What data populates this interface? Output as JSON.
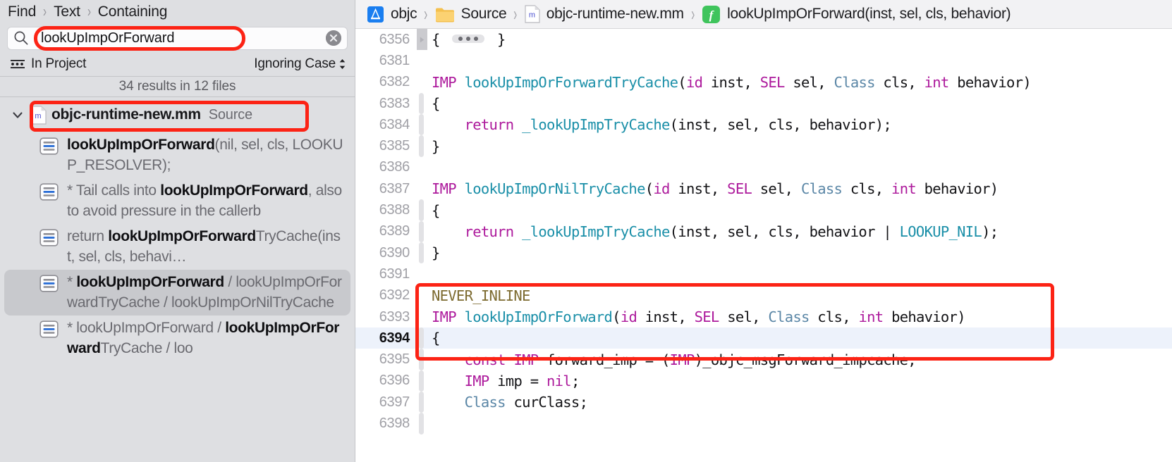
{
  "sidebar": {
    "find_scope": {
      "parts": [
        "Find",
        "Text",
        "Containing"
      ],
      "separator": "›"
    },
    "search": {
      "value": "lookUpImpOrForward",
      "placeholder": "Search",
      "magnifier_icon": "search-icon",
      "clear_icon": "clear-icon"
    },
    "filter": {
      "scope_icon": "in-project-icon",
      "scope_label": "In Project",
      "case_label": "Ignoring Case",
      "stepper_icon": "chevron-up-down-icon"
    },
    "results_count": "34 results in 12 files",
    "file_group": {
      "disclosure_icon": "chevron-down-icon",
      "file_icon": "objc-mm-file-icon",
      "name": "objc-runtime-new.mm",
      "kind": "Source",
      "expanded": true
    },
    "matches": [
      {
        "icon": "text-match-icon",
        "selected": false,
        "runs": [
          {
            "text": "lookUpImpOrForward",
            "bold": true
          },
          {
            "text": "(nil, sel, cls, LOOKUP_RESOLVER);",
            "bold": false
          }
        ]
      },
      {
        "icon": "text-match-icon",
        "selected": false,
        "runs": [
          {
            "text": "* Tail calls into ",
            "bold": false
          },
          {
            "text": "lookUpImpOrForward",
            "bold": true
          },
          {
            "text": ", also to avoid pressure in the callerb",
            "bold": false
          }
        ]
      },
      {
        "icon": "text-match-icon",
        "selected": false,
        "runs": [
          {
            "text": "return ",
            "bold": false
          },
          {
            "text": "lookUpImpOrForward",
            "bold": true
          },
          {
            "text": "TryCache(inst, sel, cls, behavi…",
            "bold": false
          }
        ]
      },
      {
        "icon": "text-match-icon",
        "selected": true,
        "runs": [
          {
            "text": "* ",
            "bold": false
          },
          {
            "text": "lookUpImpOrForward",
            "bold": true
          },
          {
            "text": " / lookUpImpOrForwardTryCache / lookUpImpOrNilTryCache",
            "bold": false
          }
        ]
      },
      {
        "icon": "text-match-icon",
        "selected": false,
        "runs": [
          {
            "text": "* lookUpImpOrForward / ",
            "bold": false
          },
          {
            "text": "lookUpImpOrForward",
            "bold": true
          },
          {
            "text": "TryCache / loo",
            "bold": false
          }
        ]
      }
    ]
  },
  "editor": {
    "jumpbar": {
      "separator": "›",
      "items": [
        {
          "icon": "xcode-project-icon",
          "label": "objc"
        },
        {
          "icon": "folder-icon",
          "label": "Source"
        },
        {
          "icon": "objc-mm-file-icon",
          "label": "objc-runtime-new.mm"
        },
        {
          "icon": "function-icon",
          "label": "lookUpImpOrForward(inst, sel, cls, behavior)"
        }
      ]
    },
    "current_line": 6394,
    "lines": [
      {
        "num": "6356",
        "fold": true,
        "blockbar": false,
        "tokens": [
          {
            "t": "{ ",
            "c": "pl"
          },
          {
            "t": "FOLD_PILL",
            "c": "fold"
          },
          {
            "t": " }",
            "c": "pl"
          }
        ]
      },
      {
        "num": "6381",
        "fold": false,
        "blockbar": false,
        "tokens": []
      },
      {
        "num": "6382",
        "fold": false,
        "blockbar": false,
        "tokens": [
          {
            "t": "IMP",
            "c": "k"
          },
          {
            "t": " ",
            "c": "pl"
          },
          {
            "t": "lookUpImpOrForwardTryCache",
            "c": "t"
          },
          {
            "t": "(",
            "c": "pl"
          },
          {
            "t": "id",
            "c": "k"
          },
          {
            "t": " inst, ",
            "c": "pl"
          },
          {
            "t": "SEL",
            "c": "k"
          },
          {
            "t": " sel, ",
            "c": "pl"
          },
          {
            "t": "Class",
            "c": "ty"
          },
          {
            "t": " cls, ",
            "c": "pl"
          },
          {
            "t": "int",
            "c": "k"
          },
          {
            "t": " behavior)",
            "c": "pl"
          }
        ]
      },
      {
        "num": "6383",
        "fold": false,
        "blockbar": true,
        "tokens": [
          {
            "t": "{",
            "c": "pl"
          }
        ]
      },
      {
        "num": "6384",
        "fold": false,
        "blockbar": true,
        "tokens": [
          {
            "t": "    ",
            "c": "pl"
          },
          {
            "t": "return",
            "c": "k"
          },
          {
            "t": " ",
            "c": "pl"
          },
          {
            "t": "_lookUpImpTryCache",
            "c": "t"
          },
          {
            "t": "(inst, sel, cls, behavior);",
            "c": "pl"
          }
        ]
      },
      {
        "num": "6385",
        "fold": false,
        "blockbar": true,
        "tokens": [
          {
            "t": "}",
            "c": "pl"
          }
        ]
      },
      {
        "num": "6386",
        "fold": false,
        "blockbar": false,
        "tokens": []
      },
      {
        "num": "6387",
        "fold": false,
        "blockbar": false,
        "tokens": [
          {
            "t": "IMP",
            "c": "k"
          },
          {
            "t": " ",
            "c": "pl"
          },
          {
            "t": "lookUpImpOrNilTryCache",
            "c": "t"
          },
          {
            "t": "(",
            "c": "pl"
          },
          {
            "t": "id",
            "c": "k"
          },
          {
            "t": " inst, ",
            "c": "pl"
          },
          {
            "t": "SEL",
            "c": "k"
          },
          {
            "t": " sel, ",
            "c": "pl"
          },
          {
            "t": "Class",
            "c": "ty"
          },
          {
            "t": " cls, ",
            "c": "pl"
          },
          {
            "t": "int",
            "c": "k"
          },
          {
            "t": " behavior)",
            "c": "pl"
          }
        ]
      },
      {
        "num": "6388",
        "fold": false,
        "blockbar": true,
        "tokens": [
          {
            "t": "{",
            "c": "pl"
          }
        ]
      },
      {
        "num": "6389",
        "fold": false,
        "blockbar": true,
        "tokens": [
          {
            "t": "    ",
            "c": "pl"
          },
          {
            "t": "return",
            "c": "k"
          },
          {
            "t": " ",
            "c": "pl"
          },
          {
            "t": "_lookUpImpTryCache",
            "c": "t"
          },
          {
            "t": "(inst, sel, cls, behavior | ",
            "c": "pl"
          },
          {
            "t": "LOOKUP_NIL",
            "c": "t"
          },
          {
            "t": ");",
            "c": "pl"
          }
        ]
      },
      {
        "num": "6390",
        "fold": false,
        "blockbar": true,
        "tokens": [
          {
            "t": "}",
            "c": "pl"
          }
        ]
      },
      {
        "num": "6391",
        "fold": false,
        "blockbar": false,
        "tokens": []
      },
      {
        "num": "6392",
        "fold": false,
        "blockbar": false,
        "tokens": [
          {
            "t": "NEVER_INLINE",
            "c": "mc"
          }
        ]
      },
      {
        "num": "6393",
        "fold": false,
        "blockbar": false,
        "tokens": [
          {
            "t": "IMP",
            "c": "k"
          },
          {
            "t": " ",
            "c": "pl"
          },
          {
            "t": "lookUpImpOrForward",
            "c": "t"
          },
          {
            "t": "(",
            "c": "pl"
          },
          {
            "t": "id",
            "c": "k"
          },
          {
            "t": " inst, ",
            "c": "pl"
          },
          {
            "t": "SEL",
            "c": "k"
          },
          {
            "t": " sel, ",
            "c": "pl"
          },
          {
            "t": "Class",
            "c": "ty"
          },
          {
            "t": " cls, ",
            "c": "pl"
          },
          {
            "t": "int",
            "c": "k"
          },
          {
            "t": " behavior)",
            "c": "pl"
          }
        ]
      },
      {
        "num": "6394",
        "fold": false,
        "blockbar": true,
        "current": true,
        "tokens": [
          {
            "t": "{",
            "c": "pl"
          }
        ]
      },
      {
        "num": "6395",
        "fold": false,
        "blockbar": true,
        "tokens": [
          {
            "t": "    ",
            "c": "pl"
          },
          {
            "t": "const",
            "c": "k"
          },
          {
            "t": " ",
            "c": "pl"
          },
          {
            "t": "IMP",
            "c": "k"
          },
          {
            "t": " forward_imp = (",
            "c": "pl"
          },
          {
            "t": "IMP",
            "c": "k"
          },
          {
            "t": ")_objc_msgForward_impcache;",
            "c": "pl"
          }
        ]
      },
      {
        "num": "6396",
        "fold": false,
        "blockbar": true,
        "tokens": [
          {
            "t": "    ",
            "c": "pl"
          },
          {
            "t": "IMP",
            "c": "k"
          },
          {
            "t": " imp = ",
            "c": "pl"
          },
          {
            "t": "nil",
            "c": "k"
          },
          {
            "t": ";",
            "c": "pl"
          }
        ]
      },
      {
        "num": "6397",
        "fold": false,
        "blockbar": true,
        "tokens": [
          {
            "t": "    ",
            "c": "pl"
          },
          {
            "t": "Class",
            "c": "ty"
          },
          {
            "t": " curClass;",
            "c": "pl"
          }
        ]
      },
      {
        "num": "6398",
        "fold": false,
        "blockbar": true,
        "tokens": []
      }
    ]
  },
  "annotations": {
    "color": "#fc2315",
    "boxes": [
      "search-field-highlight",
      "file-row-highlight",
      "code-function-highlight"
    ]
  }
}
